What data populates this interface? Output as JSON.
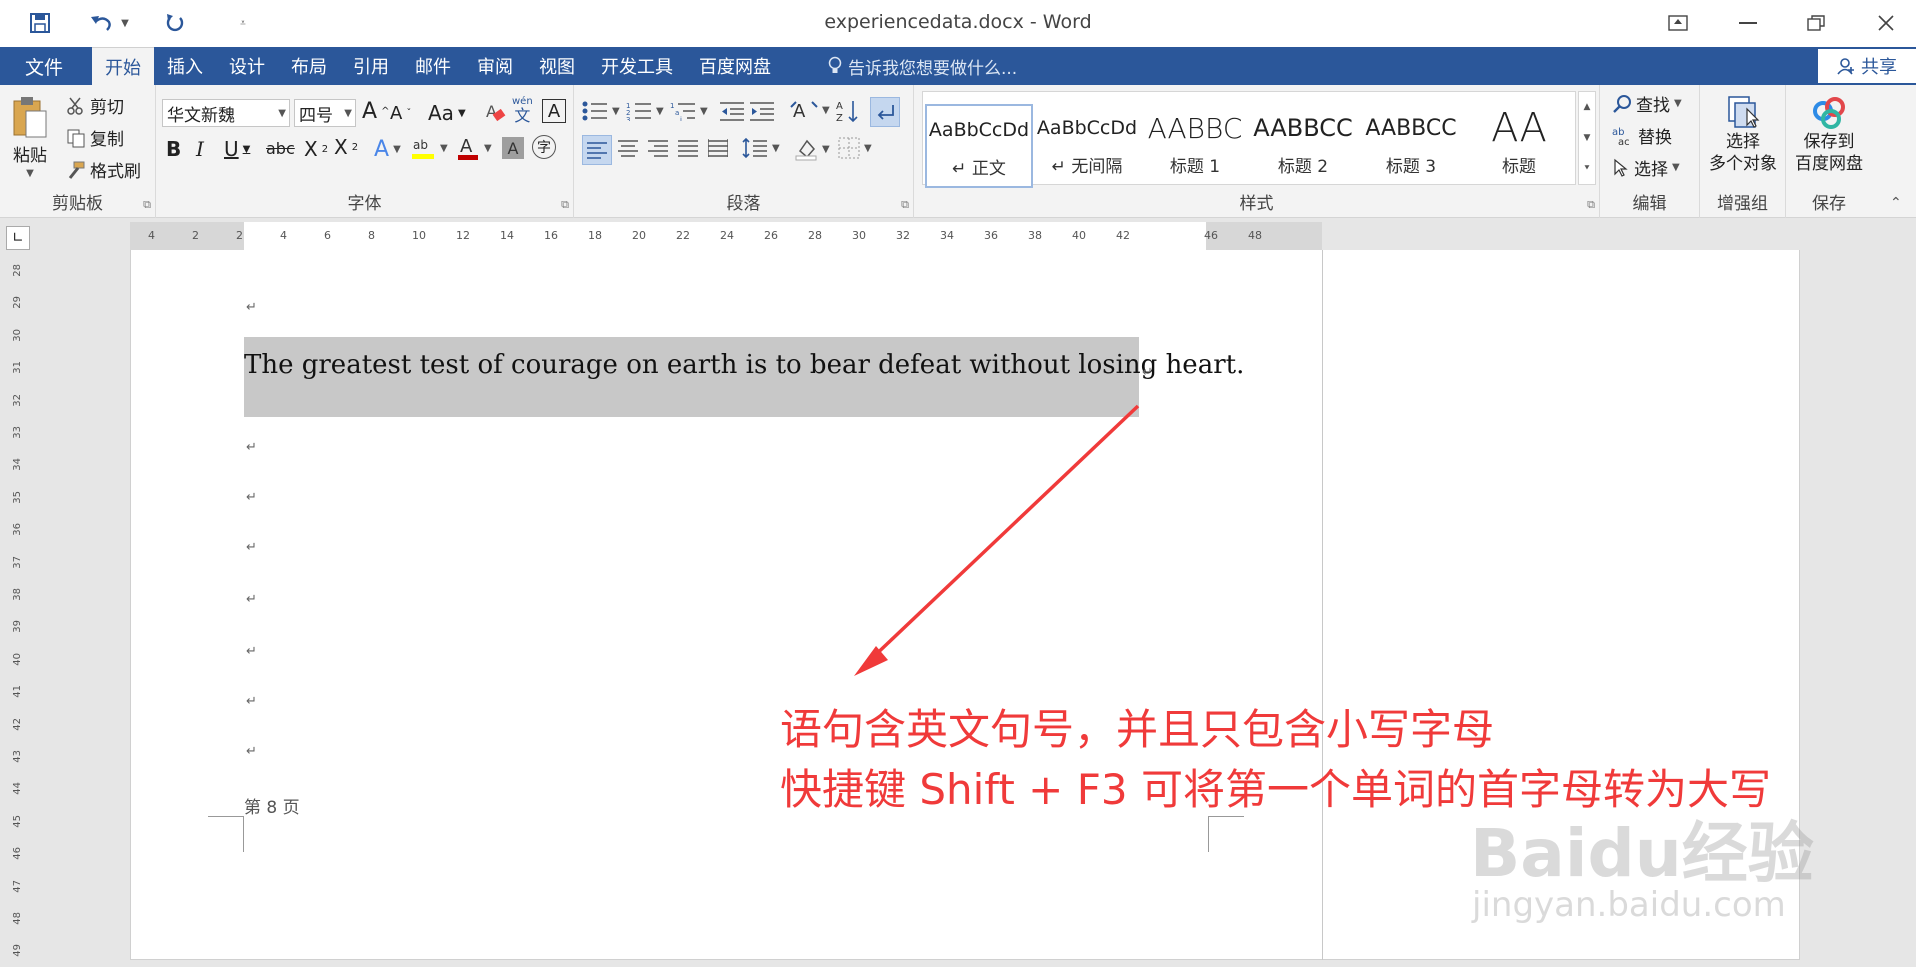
{
  "app": {
    "doc_title": "experiencedata.docx - Word"
  },
  "quick_access": {
    "save_icon": "save-icon",
    "undo_icon": "undo-icon",
    "redo_icon": "redo-icon"
  },
  "tabs": {
    "file": "文件",
    "items": [
      "开始",
      "插入",
      "设计",
      "布局",
      "引用",
      "邮件",
      "审阅",
      "视图",
      "开发工具",
      "百度网盘"
    ],
    "tell_me": "告诉我您想要做什么...",
    "share": "共享"
  },
  "ribbon": {
    "clipboard": {
      "paste": "粘贴",
      "cut": "剪切",
      "copy": "复制",
      "format_painter": "格式刷",
      "label": "剪贴板"
    },
    "font": {
      "font_name": "华文新魏",
      "font_size": "四号",
      "label": "字体"
    },
    "paragraph": {
      "label": "段落"
    },
    "styles": {
      "items": [
        {
          "sample": "AaBbCcDd",
          "name": "↵ 正文"
        },
        {
          "sample": "AaBbCcDd",
          "name": "↵ 无间隔"
        },
        {
          "sample": "AABBC",
          "name": "标题 1"
        },
        {
          "sample": "AABBCC",
          "name": "标题 2"
        },
        {
          "sample": "AABBCC",
          "name": "标题 3"
        },
        {
          "sample": "AA",
          "name": "标题"
        }
      ],
      "label": "样式"
    },
    "editing": {
      "find": "查找",
      "replace": "替换",
      "select": "选择",
      "label": "编辑"
    },
    "enhance": {
      "select_multi_line1": "选择",
      "select_multi_line2": "多个对象",
      "label": "增强组"
    },
    "save": {
      "save_line1": "保存到",
      "save_line2": "百度网盘",
      "label": "保存"
    }
  },
  "ruler_h": [
    "4",
    "2",
    "2",
    "4",
    "6",
    "8",
    "10",
    "12",
    "14",
    "16",
    "18",
    "20",
    "22",
    "24",
    "26",
    "28",
    "30",
    "32",
    "34",
    "36",
    "38",
    "40",
    "42",
    "46",
    "48"
  ],
  "ruler_v": [
    "28",
    "29",
    "30",
    "31",
    "32",
    "33",
    "34",
    "35",
    "36",
    "37",
    "38",
    "39",
    "40",
    "41",
    "42",
    "43",
    "44",
    "45",
    "46",
    "47",
    "48",
    "49"
  ],
  "document": {
    "sentence": "The greatest test of courage on earth is to bear defeat without losing heart.",
    "page_number": "第 8 页",
    "annotation_line1": "语句含英文句号，并且只包含小写字母",
    "annotation_line2": "快捷键 Shift + F3 可将第一个单词的首字母转为大写"
  },
  "watermark": {
    "logo": "Baidu经验",
    "url": "jingyan.baidu.com"
  },
  "colors": {
    "accent": "#2b579a",
    "annotation": "#f03a3a",
    "selection": "#c8c8c8"
  }
}
